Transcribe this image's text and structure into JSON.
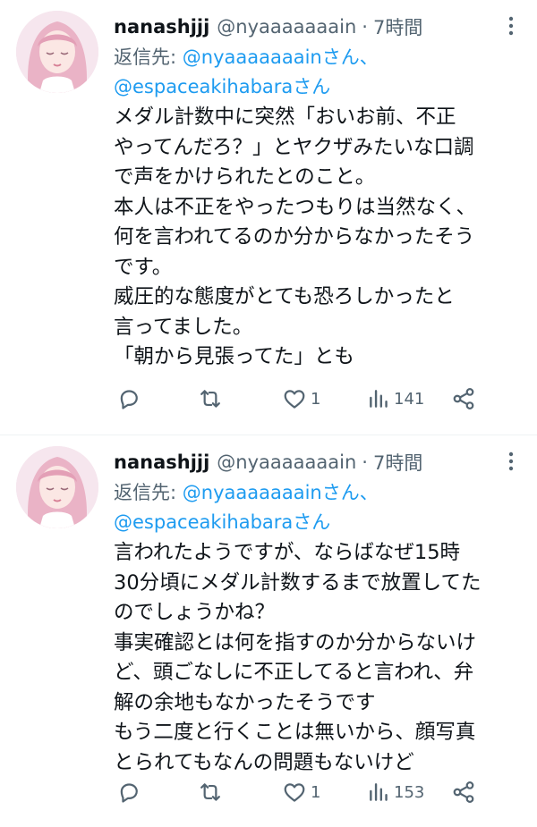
{
  "tweets": [
    {
      "author_name": "nanashjjj",
      "handle": "@nyaaaaaaain",
      "separator": "·",
      "time": "7時間",
      "reply_prefix": "返信先: ",
      "reply_mention_1": "@nyaaaaaaainさん、",
      "reply_mention_2": "@espaceakihabaraさん",
      "lines": [
        "メダル計数中に突然「おいお前、不正",
        "やってんだろ？」とヤクザみたいな口調",
        "で声をかけられたとのこと。",
        "本人は不正をやったつもりは当然なく、",
        "何を言われてるのか分からなかったそう",
        "です。",
        "威圧的な態度がとても恐ろしかったと",
        "言ってました。",
        "「朝から見張ってた」とも"
      ],
      "likes": "1",
      "views": "141",
      "icons": {
        "reply": "reply-icon",
        "retweet": "retweet-icon",
        "like": "heart-icon",
        "views": "views-icon",
        "share": "share-icon",
        "more": "more-icon"
      }
    },
    {
      "author_name": "nanashjjj",
      "handle": "@nyaaaaaaain",
      "separator": "·",
      "time": "7時間",
      "reply_prefix": "返信先: ",
      "reply_mention_1": "@nyaaaaaaainさん、",
      "reply_mention_2": "@espaceakihabaraさん",
      "lines": [
        "言われたようですが、ならばなぜ15時",
        "30分頃にメダル計数するまで放置してた",
        "のでしょうかね？",
        "事実確認とは何を指すのか分からないけ",
        "ど、頭ごなしに不正してると言われ、弁",
        "解の余地もなかったそうです",
        "もう二度と行くことは無いから、顔写真",
        "とられてもなんの問題もないけど"
      ],
      "likes": "1",
      "views": "153",
      "icons": {
        "reply": "reply-icon",
        "retweet": "retweet-icon",
        "like": "heart-icon",
        "views": "views-icon",
        "share": "share-icon",
        "more": "more-icon"
      }
    }
  ],
  "colors": {
    "text": "#0f1419",
    "secondary": "#536471",
    "link": "#1d9bf0",
    "divider": "#eff3f4"
  }
}
